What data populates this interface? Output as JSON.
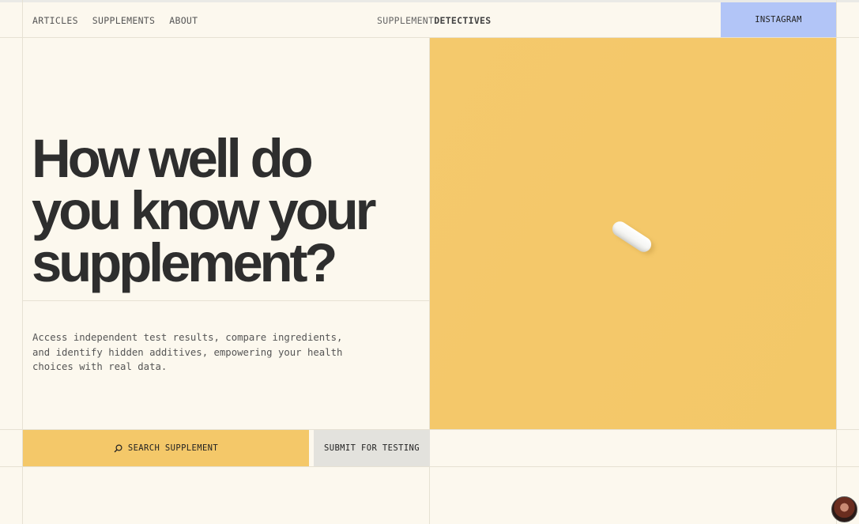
{
  "header": {
    "nav": [
      "ARTICLES",
      "SUPPLEMENTS",
      "ABOUT"
    ],
    "brand_light": "SUPPLEMENT",
    "brand_bold": "DETECTIVES",
    "instagram": "INSTAGRAM"
  },
  "hero": {
    "headline_lines": [
      "How well do",
      "you know your",
      "supplement?"
    ],
    "description": "Access independent test results, compare ingredients, and identify hidden additives, empowering your health choices with real data.",
    "image_desc_icon": "pill-capsule"
  },
  "actions": {
    "search_label": "SEARCH SUPPLEMENT",
    "search_icon": "search-icon",
    "submit_label": "SUBMIT FOR TESTING"
  },
  "colors": {
    "background": "#fcf8ee",
    "accent_yellow": "#f4c869",
    "instagram_blue": "#b2c5f7",
    "submit_gray": "#e3e2dd",
    "text_dark": "#2e2e2e"
  }
}
